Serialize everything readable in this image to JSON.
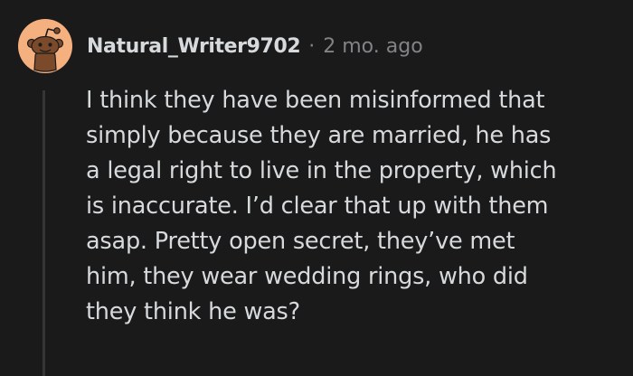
{
  "comment": {
    "author": "Natural_Writer9702",
    "separator": "·",
    "timestamp": "2 mo. ago",
    "avatar_icon": "snoo-avatar-icon",
    "body_lines": [
      "I think they have been misinformed that",
      "simply because they are married, he has",
      "a legal right to live in the property, which",
      "is inaccurate. I’d clear that up with them",
      "asap. Pretty open secret, they’ve met",
      "him, they wear wedding rings, who did",
      "they think he was?"
    ]
  },
  "colors": {
    "background": "#1a1a1b",
    "text": "#d7dadc",
    "muted": "#818384",
    "avatar_bg": "#f5b080",
    "thread_line": "#343536"
  }
}
